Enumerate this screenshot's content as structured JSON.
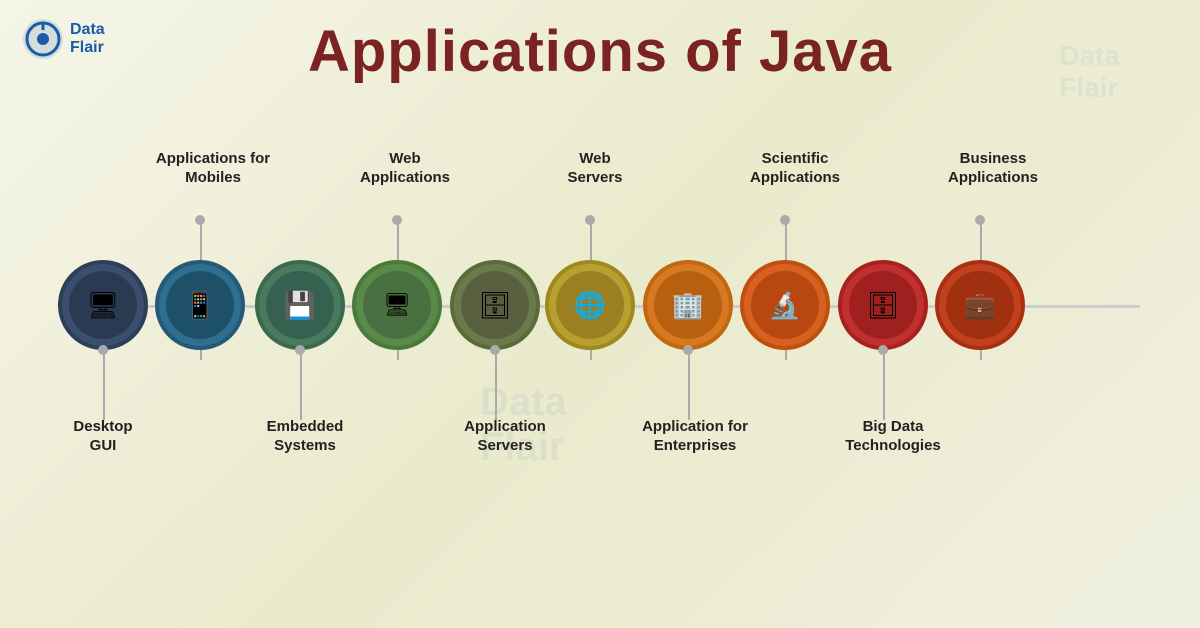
{
  "title": "Applications of Java",
  "logo": {
    "text_line1": "Data",
    "text_line2": "Flair"
  },
  "nodes": [
    {
      "id": 0,
      "icon": "🖥",
      "bottom_label": "Desktop\nGUI",
      "top_label": null,
      "color_class": "node-0",
      "x_pct": 6
    },
    {
      "id": 1,
      "icon": "📱",
      "bottom_label": null,
      "top_label": "Applications for\nMobiles",
      "color_class": "node-1",
      "x_pct": 16
    },
    {
      "id": 2,
      "icon": "💾",
      "bottom_label": "Embedded\nSystems",
      "top_label": null,
      "color_class": "node-2",
      "x_pct": 27
    },
    {
      "id": 3,
      "icon": "🖥",
      "bottom_label": null,
      "top_label": "Web\nApplications",
      "color_class": "node-3",
      "x_pct": 38
    },
    {
      "id": 4,
      "icon": "🗄",
      "bottom_label": "Application\nServers",
      "top_label": null,
      "color_class": "node-4",
      "x_pct": 48
    },
    {
      "id": 5,
      "icon": "🌐",
      "bottom_label": null,
      "top_label": "Web\nServers",
      "color_class": "node-5",
      "x_pct": 58
    },
    {
      "id": 6,
      "icon": "🏢",
      "bottom_label": "Application for\nEnterprises",
      "top_label": null,
      "color_class": "node-6",
      "x_pct": 68
    },
    {
      "id": 7,
      "icon": "🔬",
      "bottom_label": null,
      "top_label": "Scientific\nApplications",
      "color_class": "node-7",
      "x_pct": 78
    },
    {
      "id": 8,
      "icon": "🗄",
      "bottom_label": "Big Data\nTechnologies",
      "top_label": null,
      "color_class": "node-8",
      "x_pct": 88
    },
    {
      "id": 9,
      "icon": "💼",
      "bottom_label": null,
      "top_label": "Business\nApplications",
      "color_class": "node-9",
      "x_pct": 96
    }
  ]
}
